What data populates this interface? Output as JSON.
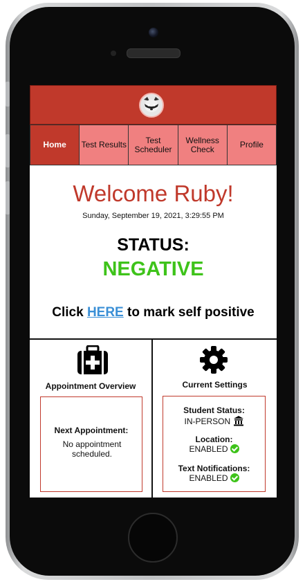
{
  "nav": {
    "items": [
      {
        "label": "Home"
      },
      {
        "label": "Test Results"
      },
      {
        "label": "Test Scheduler"
      },
      {
        "label": "Wellness Check"
      },
      {
        "label": "Profile"
      }
    ]
  },
  "welcome": {
    "greeting": "Welcome Ruby!",
    "datetime": "Sunday, September 19, 2021, 3:29:55 PM"
  },
  "status": {
    "label": "STATUS:",
    "value": "NEGATIVE"
  },
  "self_positive": {
    "prefix": "Click",
    "link": "HERE",
    "suffix": "to mark self positive"
  },
  "appointment": {
    "title": "Appointment Overview",
    "next_label": "Next Appointment:",
    "next_value": "No appointment scheduled."
  },
  "settings": {
    "title": "Current Settings",
    "student_status_label": "Student Status:",
    "student_status_value": "IN-PERSON",
    "location_label": "Location:",
    "location_value": "ENABLED",
    "notifications_label": "Text Notifications:",
    "notifications_value": "ENABLED"
  },
  "colors": {
    "brand": "#c0392b",
    "nav_inactive": "#f08080",
    "negative_status": "#3ec31a",
    "link": "#3a8fd6"
  },
  "icons": [
    "medical-kit-icon",
    "gear-icon",
    "building-icon",
    "check-circle-icon",
    "raccoon-logo"
  ]
}
